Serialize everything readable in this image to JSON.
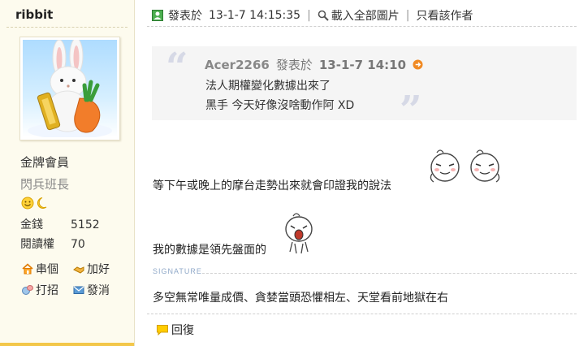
{
  "user": {
    "name": "ribbit",
    "group": "金牌會員",
    "rank": "閃兵班長",
    "stats": [
      {
        "label": "金錢",
        "value": "5152"
      },
      {
        "label": "閱讀權",
        "value": "70"
      }
    ],
    "links": [
      {
        "label": "串個",
        "icon": "home-icon"
      },
      {
        "label": "加好",
        "icon": "handshake-icon"
      },
      {
        "label": "打招",
        "icon": "greet-icon"
      },
      {
        "label": "發消",
        "icon": "mail-icon"
      }
    ]
  },
  "post": {
    "posted_prefix": "發表於",
    "posted_time": "13-1-7 14:15:35",
    "download_images": "載入全部圖片",
    "only_author": "只看該作者",
    "quote": {
      "author": "Acer2266",
      "posted_prefix": "發表於",
      "time": "13-1-7 14:10",
      "lines": [
        "法人期權變化數據出來了",
        "黑手 今天好像沒啥動作阿 XD"
      ]
    },
    "message_lines": [
      "等下午或晚上的摩台走勢出來就會印證我的說法",
      "我的數據是領先盤面的"
    ],
    "signature_label": "SIGNATURE",
    "signature": "多空無常唯量成價、貪婪當頭恐懼相左、天堂看前地獄在右",
    "reply_label": "回復"
  },
  "colors": {
    "sidebar_bg": "#fdfbee",
    "accent_yellow": "#f3c74a",
    "quote_bg": "#f5f5f5"
  }
}
